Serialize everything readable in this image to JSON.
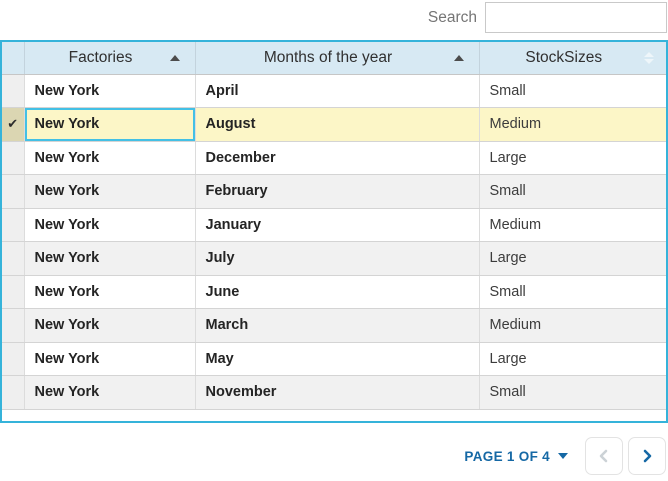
{
  "search": {
    "label": "Search",
    "value": ""
  },
  "grid": {
    "columns": [
      {
        "label": "Factories",
        "sort": "asc"
      },
      {
        "label": "Months of the year",
        "sort": "asc"
      },
      {
        "label": "StockSizes",
        "sort": "none"
      }
    ],
    "rows": [
      {
        "factory": "New York",
        "month": "April",
        "size": "Small",
        "selected": false
      },
      {
        "factory": "New York",
        "month": "August",
        "size": "Medium",
        "selected": true
      },
      {
        "factory": "New York",
        "month": "December",
        "size": "Large",
        "selected": false
      },
      {
        "factory": "New York",
        "month": "February",
        "size": "Small",
        "selected": false
      },
      {
        "factory": "New York",
        "month": "January",
        "size": "Medium",
        "selected": false
      },
      {
        "factory": "New York",
        "month": "July",
        "size": "Large",
        "selected": false
      },
      {
        "factory": "New York",
        "month": "June",
        "size": "Small",
        "selected": false
      },
      {
        "factory": "New York",
        "month": "March",
        "size": "Medium",
        "selected": false
      },
      {
        "factory": "New York",
        "month": "May",
        "size": "Large",
        "selected": false
      },
      {
        "factory": "New York",
        "month": "November",
        "size": "Small",
        "selected": false
      }
    ],
    "icons": {
      "check": "✔"
    }
  },
  "pager": {
    "label": "PAGE 1 OF 4",
    "prev_enabled": false,
    "next_enabled": true
  },
  "colors": {
    "grid_border": "#35b3da",
    "header_bg": "#d7e9f3",
    "selected_row_bg": "#fcf6c7",
    "selected_gutter_bg": "#dbd6b2",
    "alt_row_bg": "#f1f1f1",
    "focus_cell_border": "#43c0e5",
    "pager_text": "#1568a5"
  }
}
